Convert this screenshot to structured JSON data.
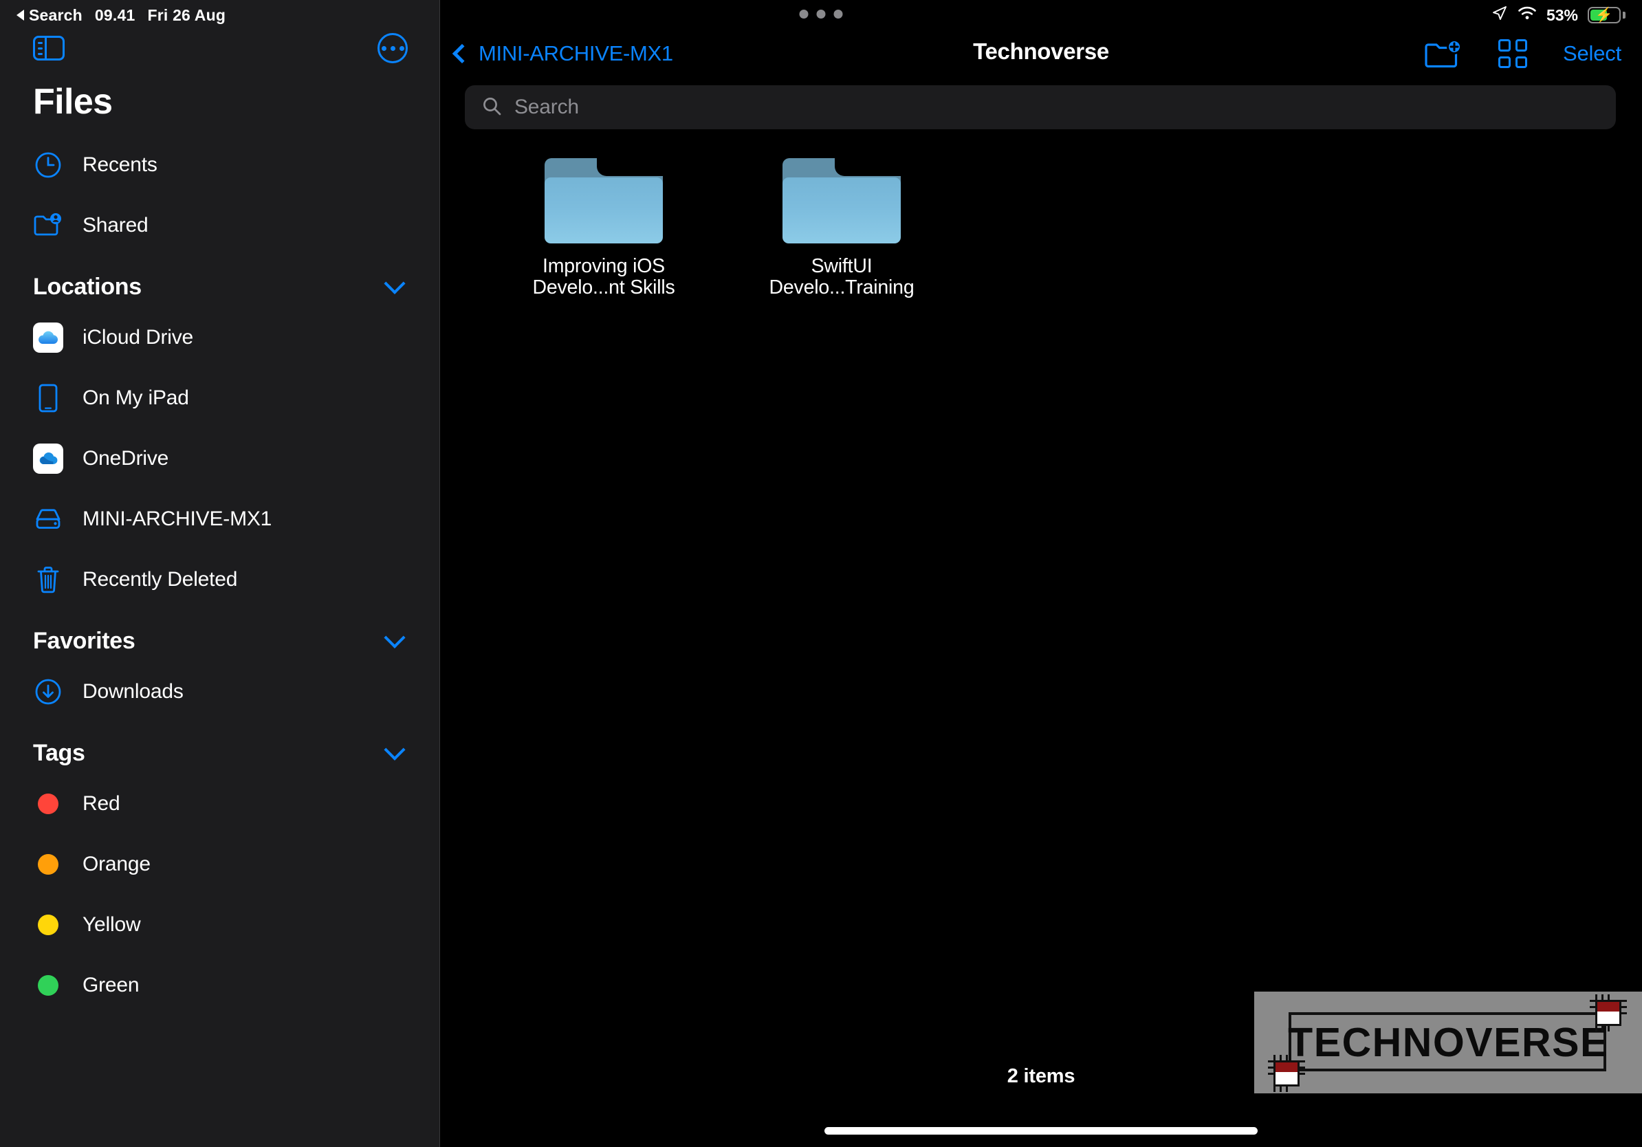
{
  "status_bar": {
    "back_app": "Search",
    "time": "09.41",
    "date": "Fri 26 Aug",
    "battery_percent": "53%",
    "location_icon": "location-arrow-icon",
    "wifi_icon": "wifi-icon",
    "battery_icon": "battery-charging-icon",
    "multitask_icon": "multitasking-dots-icon"
  },
  "sidebar": {
    "toggle_icon": "sidebar-toggle-icon",
    "more_icon": "more-circle-icon",
    "title": "Files",
    "quick_items": [
      {
        "label": "Recents",
        "icon": "clock-icon"
      },
      {
        "label": "Shared",
        "icon": "shared-folder-icon"
      }
    ],
    "sections": [
      {
        "title": "Locations",
        "chevron": "chevron-down-icon",
        "items": [
          {
            "label": "iCloud Drive",
            "icon": "icloud-drive-icon"
          },
          {
            "label": "On My iPad",
            "icon": "ipad-icon"
          },
          {
            "label": "OneDrive",
            "icon": "onedrive-icon"
          },
          {
            "label": "MINI-ARCHIVE-MX1",
            "icon": "external-drive-icon"
          },
          {
            "label": "Recently Deleted",
            "icon": "trash-icon"
          }
        ]
      },
      {
        "title": "Favorites",
        "chevron": "chevron-down-icon",
        "items": [
          {
            "label": "Downloads",
            "icon": "download-circle-icon"
          }
        ]
      },
      {
        "title": "Tags",
        "chevron": "chevron-down-icon",
        "items": [
          {
            "label": "Red",
            "icon": "tag-dot-icon",
            "color": "#FF453A"
          },
          {
            "label": "Orange",
            "icon": "tag-dot-icon",
            "color": "#FF9F0A"
          },
          {
            "label": "Yellow",
            "icon": "tag-dot-icon",
            "color": "#FFD60A"
          },
          {
            "label": "Green",
            "icon": "tag-dot-icon",
            "color": "#30D158"
          }
        ]
      }
    ]
  },
  "navbar": {
    "back_label": "MINI-ARCHIVE-MX1",
    "back_chevron": "chevron-left-icon",
    "title": "Technoverse",
    "new_folder_icon": "new-folder-icon",
    "view_grid_icon": "grid-view-icon",
    "select_label": "Select"
  },
  "search": {
    "placeholder": "Search",
    "value": "",
    "icon": "search-icon"
  },
  "content": {
    "folders": [
      {
        "name": "Improving iOS\nDevelo...nt Skills",
        "line1": "Improving iOS",
        "line2": "Develo...nt Skills",
        "icon": "folder-icon"
      },
      {
        "name": "SwiftUI\nDevelo...Training",
        "line1": "SwiftUI",
        "line2": "Develo...Training",
        "icon": "folder-icon"
      }
    ],
    "item_count": "2 items"
  },
  "watermark": {
    "text": "TECHNOVERSE"
  },
  "colors": {
    "accent": "#0A84FF",
    "sidebar_bg": "#1C1C1E",
    "main_bg": "#000000",
    "separator": "#38383A",
    "placeholder": "#8E8E93",
    "battery_green": "#32D74B",
    "folder_front_top": "#75B5D6",
    "folder_front_bottom": "#8CCBE7",
    "folder_back": "#5F8FA8"
  }
}
